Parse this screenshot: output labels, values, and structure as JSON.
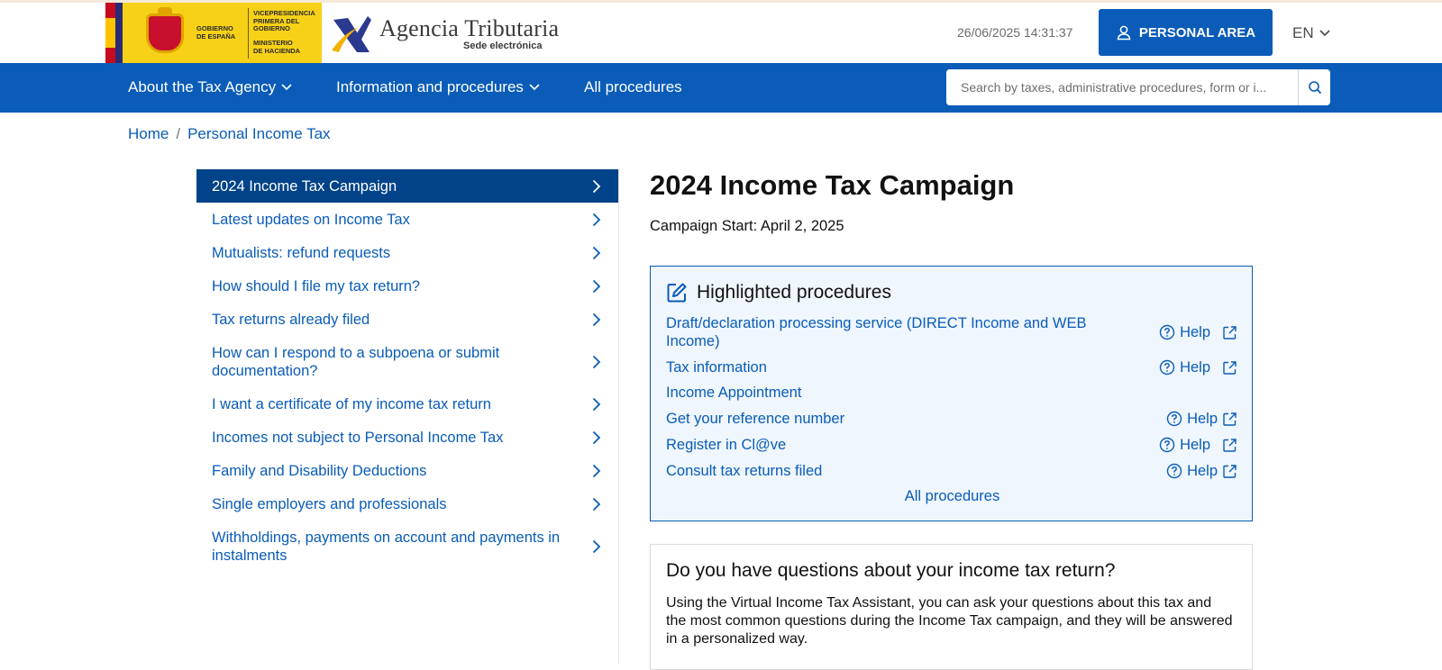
{
  "header": {
    "gov_logo": {
      "line1": "GOBIERNO",
      "line2": "DE ESPAÑA",
      "line3": "VICEPRESIDENCIA",
      "line4": "PRIMERA DEL GOBIERNO",
      "line5": "MINISTERIO",
      "line6": "DE HACIENDA"
    },
    "agency_name": "Agencia Tributaria",
    "agency_sub": "Sede electrónica",
    "datetime": "26/06/2025 14:31:37",
    "personal_area": "PERSONAL AREA",
    "language": "EN",
    "brand_color": "#0a5cb8"
  },
  "nav": {
    "items": [
      {
        "label": "About the Tax Agency",
        "dropdown": true
      },
      {
        "label": "Information and procedures",
        "dropdown": true
      },
      {
        "label": "All procedures",
        "dropdown": false
      }
    ],
    "search_placeholder": "Search by taxes, administrative procedures, form or i..."
  },
  "breadcrumb": {
    "items": [
      "Home",
      "Personal Income Tax"
    ],
    "separator": "/"
  },
  "sidebar": {
    "items": [
      {
        "label": "2024 Income Tax Campaign",
        "active": true
      },
      {
        "label": "Latest updates on Income Tax"
      },
      {
        "label": "Mutualists: refund requests"
      },
      {
        "label": "How should I file my tax return?"
      },
      {
        "label": "Tax returns already filed"
      },
      {
        "label": "How can I respond to a subpoena or submit documentation?"
      },
      {
        "label": "I want a certificate of my income tax return"
      },
      {
        "label": "Incomes not subject to Personal Income Tax"
      },
      {
        "label": "Family and Disability Deductions"
      },
      {
        "label": "Single employers and professionals"
      },
      {
        "label": "Withholdings, payments on account and payments in instalments"
      }
    ]
  },
  "main": {
    "title": "2024 Income Tax Campaign",
    "campaign_start": "Campaign Start: April 2, 2025",
    "highlighted": {
      "title": "Highlighted procedures",
      "help_label": "Help",
      "items": [
        {
          "label": "Draft/declaration processing service (DIRECT Income and WEB Income)",
          "help": true
        },
        {
          "label": "Tax information",
          "help": true
        },
        {
          "label": "Income Appointment",
          "help": false
        },
        {
          "label": "Get your reference number",
          "help": true
        },
        {
          "label": "Register in Cl@ve",
          "help": true
        },
        {
          "label": "Consult tax returns filed",
          "help": true
        }
      ],
      "all_procedures": "All procedures"
    },
    "questions": {
      "title": "Do you have questions about your income tax return?",
      "text": "Using the Virtual Income Tax Assistant, you can ask your questions about this tax and the most common questions during the Income Tax campaign, and they will be answered in a personalized way."
    }
  },
  "icons": {
    "user": "user-icon",
    "chevron_down": "chevron-down-icon",
    "chevron_right": "chevron-right-icon",
    "search": "search-icon",
    "edit": "edit-icon",
    "help": "help-circle-icon",
    "external": "external-link-icon"
  }
}
